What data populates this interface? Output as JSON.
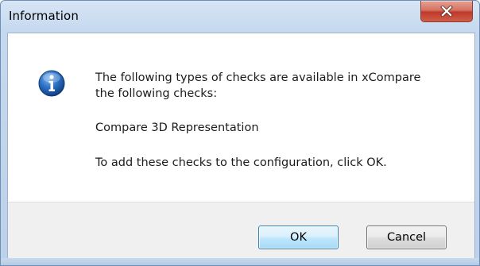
{
  "window": {
    "title": "Information"
  },
  "dialog": {
    "icon": "info-icon",
    "message_line_1": "The following types of checks are available in xCompare",
    "message_line_2": "the following checks:",
    "check_item": "Compare 3D Representation",
    "instruction": "To add these checks to the configuration, click OK."
  },
  "buttons": {
    "ok_label": "OK",
    "cancel_label": "Cancel"
  },
  "colors": {
    "close_button": "#c0392b",
    "info_icon": "#1f5fae",
    "ok_border": "#3c7fb1"
  }
}
